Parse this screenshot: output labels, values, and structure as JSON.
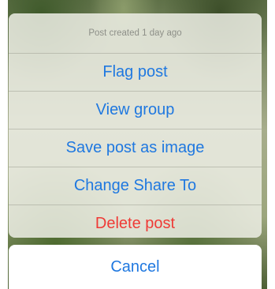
{
  "action_sheet": {
    "header": "Post created 1 day ago",
    "actions": [
      {
        "label": "Flag post",
        "destructive": false
      },
      {
        "label": "View group",
        "destructive": false
      },
      {
        "label": "Save post as image",
        "destructive": false
      },
      {
        "label": "Change Share To",
        "destructive": false
      },
      {
        "label": "Delete post",
        "destructive": true
      }
    ],
    "cancel_label": "Cancel"
  },
  "colors": {
    "action_text": "#1f78e0",
    "destructive_text": "#ef3a36",
    "header_text": "#8d8f88"
  }
}
